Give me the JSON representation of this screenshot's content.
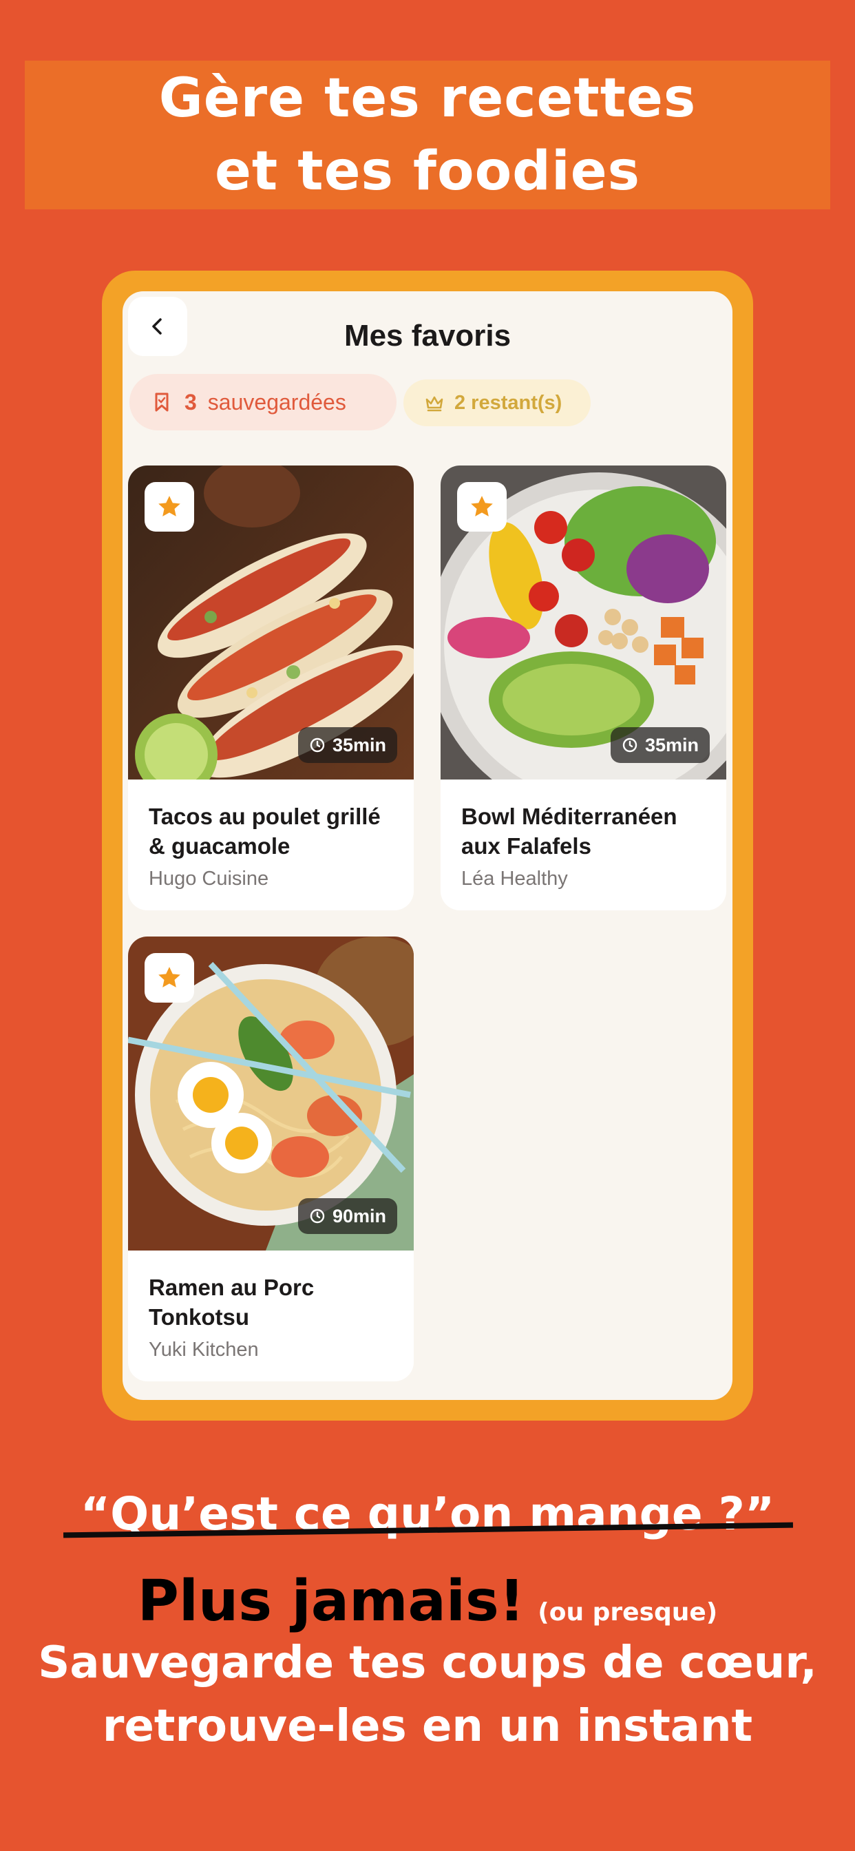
{
  "headline": {
    "line1": "Gère tes recettes",
    "line2": "et tes foodies"
  },
  "screen": {
    "title": "Mes favoris",
    "saved_count": "3",
    "saved_label": "sauvegardées",
    "remaining_label": "2 restant(s)"
  },
  "recipes": [
    {
      "title_line1": "Tacos au poulet grillé",
      "title_line2": "& guacamole",
      "author": "Hugo Cuisine",
      "time": "35min"
    },
    {
      "title_line1": "Bowl Méditerranéen",
      "title_line2": "aux Falafels",
      "author": "Léa Healthy",
      "time": "35min"
    },
    {
      "title_line1": "Ramen au Porc",
      "title_line2": "Tonkotsu",
      "author": "Yuki Kitchen",
      "time": "90min"
    }
  ],
  "tagline": {
    "quote": "“Qu’est ce qu’on mange ?”",
    "never": "Plus jamais!",
    "never_note": "(ou presque)",
    "sub_line1": "Sauvegarde tes coups de cœur,",
    "sub_line2": "retrouve-les en un instant"
  },
  "colors": {
    "background": "#E6542F",
    "banner": "#EB6E28",
    "frame": "#F3A227",
    "accent": "#E05A3C",
    "star": "#F39A1E"
  }
}
